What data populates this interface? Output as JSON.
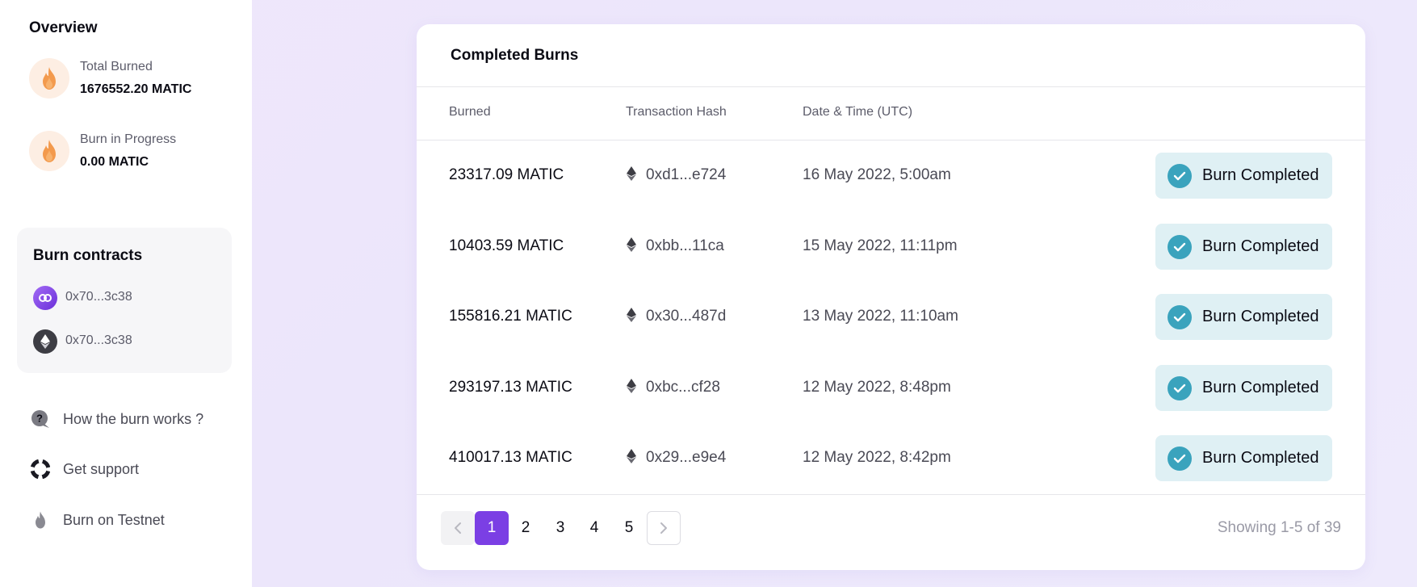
{
  "sidebar": {
    "overview_title": "Overview",
    "stats": [
      {
        "label": "Total Burned",
        "value": "1676552.20 MATIC",
        "icon": "flame-icon"
      },
      {
        "label": "Burn in Progress",
        "value": "0.00 MATIC",
        "icon": "flame-icon"
      }
    ],
    "contracts": {
      "title": "Burn contracts",
      "items": [
        {
          "address": "0x70...3c38",
          "icon": "polygon-icon"
        },
        {
          "address": "0x70...3c38",
          "icon": "ethereum-icon"
        }
      ]
    },
    "nav": [
      {
        "label": "How the burn works ?",
        "icon": "help-bubble-icon"
      },
      {
        "label": "Get support",
        "icon": "lifebuoy-icon"
      },
      {
        "label": "Burn on Testnet",
        "icon": "flame-icon"
      }
    ]
  },
  "card": {
    "title": "Completed Burns",
    "columns": [
      "Burned",
      "Transaction Hash",
      "Date & Time (UTC)"
    ],
    "rows": [
      {
        "amount": "23317.09 MATIC",
        "hash": "0xd1...e724",
        "date": "16 May 2022, 5:00am",
        "status": "Burn Completed"
      },
      {
        "amount": "10403.59 MATIC",
        "hash": "0xbb...11ca",
        "date": "15 May 2022, 11:11pm",
        "status": "Burn Completed"
      },
      {
        "amount": "155816.21 MATIC",
        "hash": "0x30...487d",
        "date": "13 May 2022, 11:10am",
        "status": "Burn Completed"
      },
      {
        "amount": "293197.13 MATIC",
        "hash": "0xbc...cf28",
        "date": "12 May 2022, 8:48pm",
        "status": "Burn Completed"
      },
      {
        "amount": "410017.13 MATIC",
        "hash": "0x29...e9e4",
        "date": "12 May 2022, 8:42pm",
        "status": "Burn Completed"
      }
    ],
    "pagination": {
      "pages": [
        "1",
        "2",
        "3",
        "4",
        "5"
      ],
      "current": "1",
      "showing": "Showing 1-5 of 39"
    }
  },
  "colors": {
    "accent": "#7b3fe4",
    "badge_bg": "#dff0f4",
    "check": "#3aa3bd",
    "flame": "#f39a4d"
  }
}
